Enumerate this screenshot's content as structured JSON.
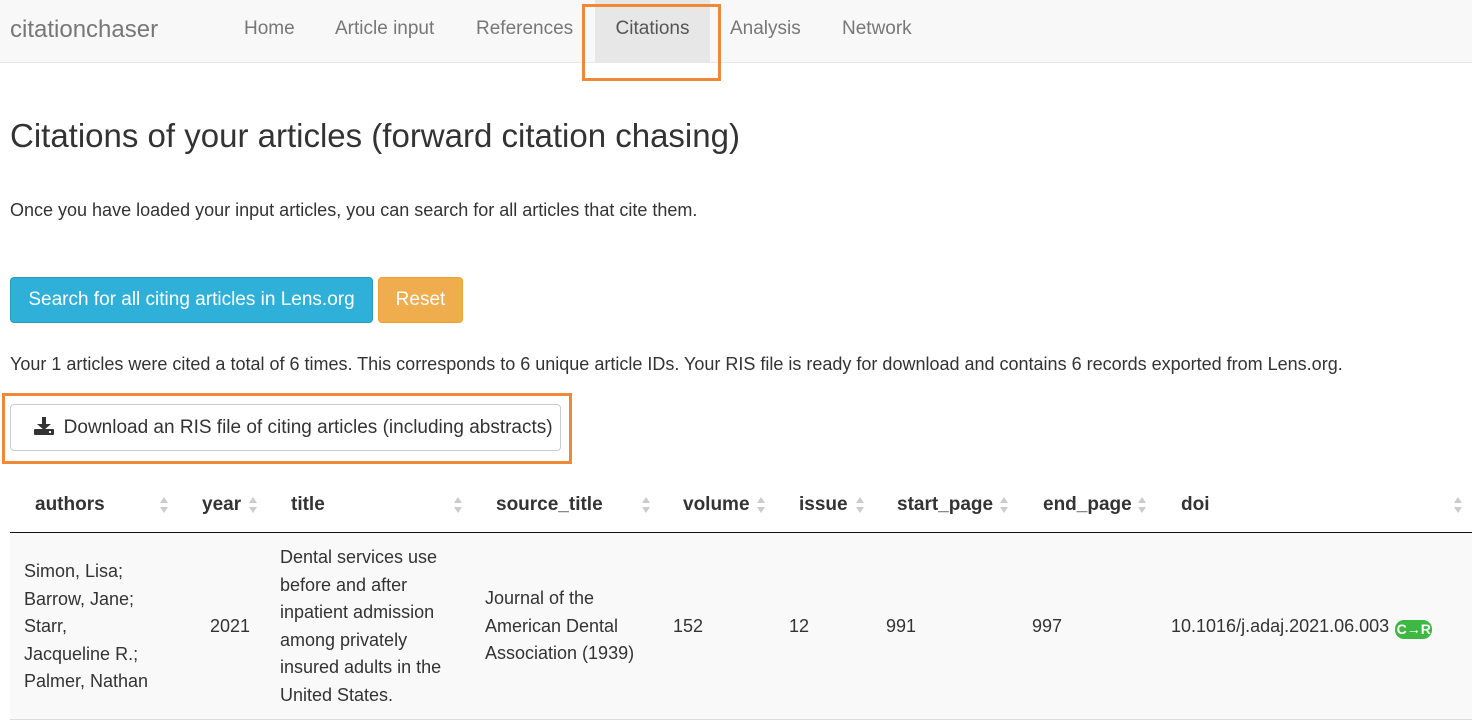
{
  "navbar": {
    "brand": "citationchaser",
    "items": [
      "Home",
      "Article input",
      "References",
      "Citations",
      "Analysis",
      "Network"
    ],
    "active": "Citations"
  },
  "page": {
    "title": "Citations of your articles (forward citation chasing)",
    "intro": "Once you have loaded your input articles, you can search for all articles that cite them.",
    "search_button": "Search for all citing articles in Lens.org",
    "reset_button": "Reset",
    "summary": "Your 1 articles were cited a total of 6 times. This corresponds to 6 unique article IDs. Your RIS file is ready for download and contains 6 records exported from Lens.org.",
    "download_button": "Download an RIS file of citing articles (including abstracts)",
    "download_icon": "download-icon"
  },
  "colors": {
    "highlight": "#f0883a",
    "search_button": "#2fb0d8",
    "reset_button": "#f0ad4e",
    "crossref_badge": "#3eb843"
  },
  "table": {
    "columns": [
      "authors",
      "year",
      "title",
      "source_title",
      "volume",
      "issue",
      "start_page",
      "end_page",
      "doi"
    ],
    "rows": [
      {
        "authors": [
          "Simon, Lisa;",
          "Barrow, Jane;",
          "Starr,",
          "Jacqueline R.;",
          "Palmer, Nathan"
        ],
        "year": "2021",
        "title": [
          "Dental services use",
          "before and after",
          "inpatient admission",
          "among privately",
          "insured adults in the",
          "United States."
        ],
        "source_title": [
          "Journal of the",
          "American Dental",
          "Association (1939)"
        ],
        "volume": "152",
        "issue": "12",
        "start_page": "991",
        "end_page": "997",
        "doi": "10.1016/j.adaj.2021.06.003",
        "doi_badge": "C→R"
      }
    ]
  }
}
